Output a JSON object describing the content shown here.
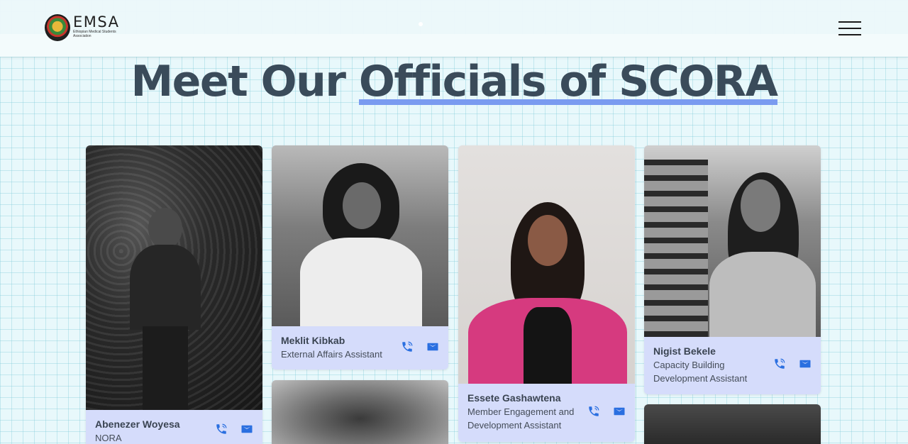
{
  "header": {
    "logo_title": "EMSA",
    "logo_subtitle": "Ethiopian Medical Students Association",
    "menu_icon": "hamburger-menu-icon"
  },
  "heading": {
    "part1": "Meet Our ",
    "part2": "Officials of SCORA"
  },
  "colors": {
    "accent": "#7a9bf0",
    "card_bg": "#d5dcfb",
    "icon_blue": "#2a6fe0",
    "heading": "#3a4b5a"
  },
  "officials": [
    {
      "name": "Abenezer Woyesa",
      "role": "NORA"
    },
    {
      "name": "Meklit Kibkab",
      "role": "External Affairs Assistant"
    },
    {
      "name": "Essete Gashawtena",
      "role": "Member Engagement and Development Assistant"
    },
    {
      "name": "Nigist Bekele",
      "role": "Capacity Building Development Assistant"
    }
  ]
}
